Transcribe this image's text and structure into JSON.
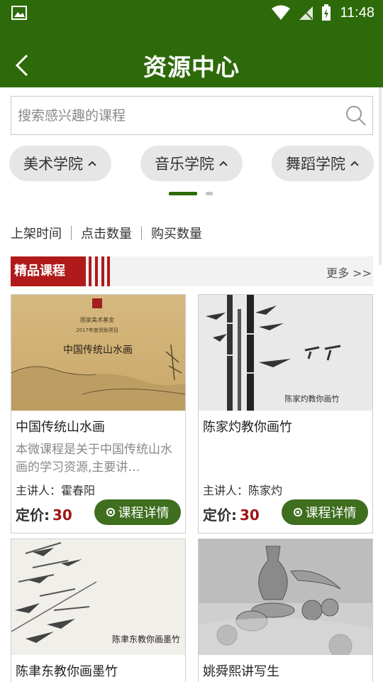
{
  "status_bar": {
    "time": "11:48"
  },
  "header": {
    "title": "资源中心"
  },
  "search": {
    "placeholder": "搜索感兴趣的课程"
  },
  "categories": [
    {
      "label": "美术学院"
    },
    {
      "label": "音乐学院"
    },
    {
      "label": "舞蹈学院"
    }
  ],
  "sort_options": [
    {
      "label": "上架时间"
    },
    {
      "label": "点击数量"
    },
    {
      "label": "购买数量"
    }
  ],
  "section": {
    "title": "精品课程",
    "more": "更多 >>"
  },
  "courses": [
    {
      "name": "中国传统山水画",
      "description": "本微课程是关于中国传统山水画的学习资源,主要讲…",
      "lecturer": "主讲人：霍春阳",
      "price_label": "定价:",
      "price": "30",
      "detail_label": "课程详情",
      "thumb_title": "中国传统山水画",
      "thumb_caption_1": "国家美术基金",
      "thumb_caption_2": "2017年度资助项目"
    },
    {
      "name": "陈家灼教你画竹",
      "description": "",
      "lecturer": "主讲人：陈家灼",
      "price_label": "定价:",
      "price": "30",
      "detail_label": "课程详情",
      "thumb_title": "陈家灼教你画竹"
    },
    {
      "name": "陈聿东教你画墨竹",
      "thumb_title": "陈聿东教你画墨竹"
    },
    {
      "name": "姚舜熙讲写生"
    }
  ],
  "colors": {
    "primary": "#2d6a0a",
    "accent_red": "#b01a1a",
    "price_red": "#a01616",
    "button_green": "#3f6e1e"
  }
}
